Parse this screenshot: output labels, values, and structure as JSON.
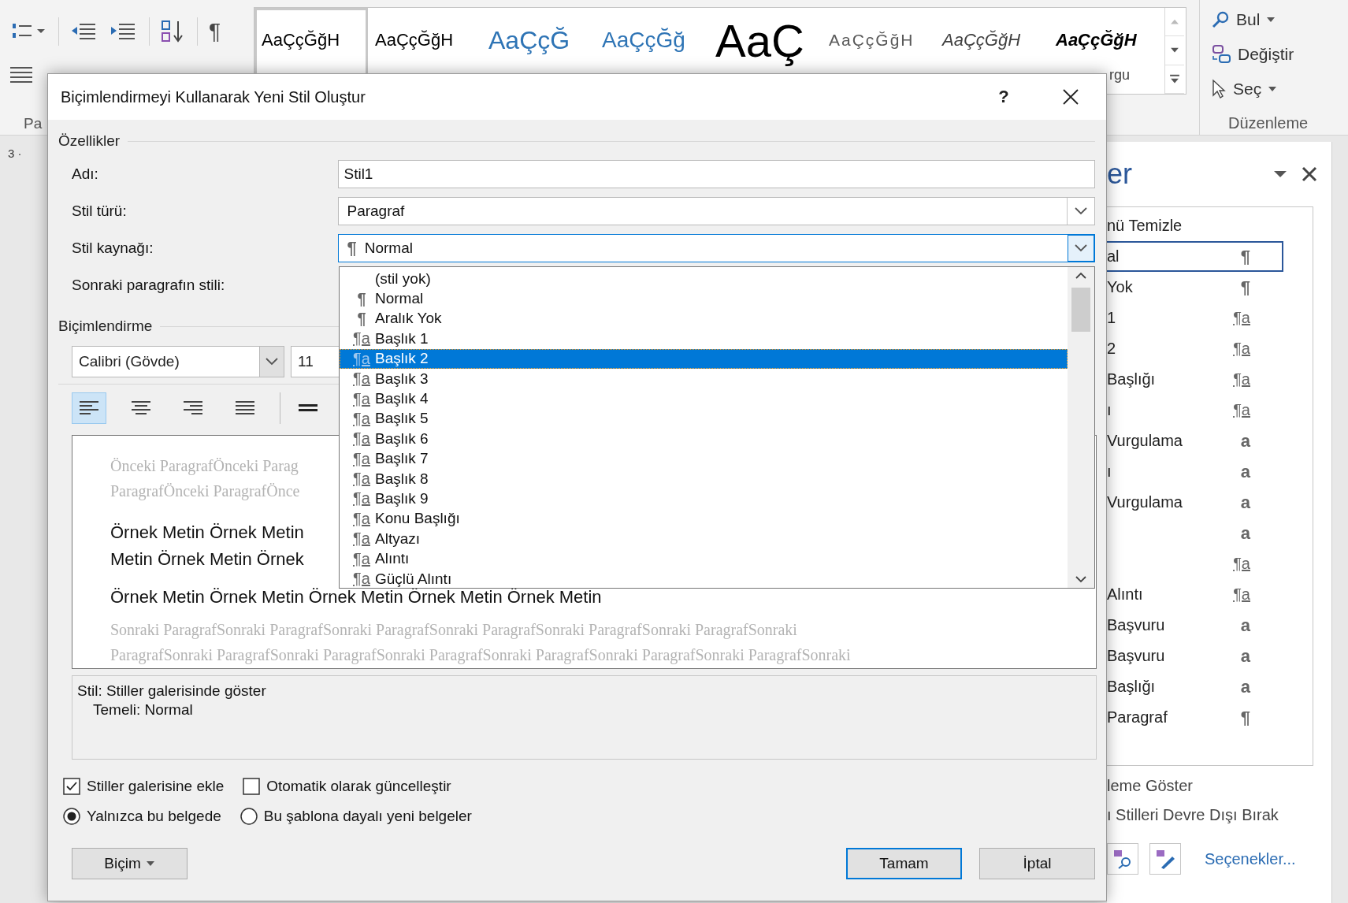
{
  "ribbon": {
    "paragraph_mark": "¶",
    "group_label": "Pa",
    "ruler": "3 ·",
    "gallery": [
      {
        "sample": "AaÇçĞğH",
        "kind": "normal",
        "selected": true
      },
      {
        "sample": "AaÇçĞğH",
        "kind": "no-spacing",
        "selected": false
      },
      {
        "sample": "AaÇçĞ",
        "kind": "heading1",
        "selected": false
      },
      {
        "sample": "AaÇçĞğ",
        "kind": "heading2",
        "selected": false
      },
      {
        "sample": "AaÇ",
        "kind": "title",
        "selected": false
      },
      {
        "sample": "AaÇçĞğH",
        "kind": "subtitle",
        "selected": false
      },
      {
        "sample": "AaÇçĞğH",
        "kind": "subtle-emphasis",
        "selected": false
      },
      {
        "sample": "AaÇçĞğH",
        "kind": "emphasis",
        "selected": false,
        "label": "rgu"
      }
    ],
    "editing": [
      {
        "label": "Bul",
        "kind": "find"
      },
      {
        "label": "Değiştir",
        "kind": "replace"
      },
      {
        "label": "Seç",
        "kind": "select"
      }
    ],
    "editing_group": "Düzenleme"
  },
  "styles_pane": {
    "title": "er",
    "items": [
      {
        "label": "nü Temizle",
        "kind": "clear",
        "selected": false
      },
      {
        "label": "al",
        "mark": "¶",
        "kind": "paragraph",
        "selected": true
      },
      {
        "label": "Yok",
        "mark": "¶",
        "kind": "paragraph",
        "selected": false
      },
      {
        "label": "1",
        "mark": "¶a",
        "kind": "linked",
        "selected": false
      },
      {
        "label": "2",
        "mark": "¶a",
        "kind": "linked",
        "selected": false
      },
      {
        "label": "Başlığı",
        "mark": "¶a",
        "kind": "linked",
        "selected": false
      },
      {
        "label": "ı",
        "mark": "¶a",
        "kind": "linked",
        "selected": false
      },
      {
        "label": "Vurgulama",
        "mark": "a",
        "kind": "character",
        "selected": false
      },
      {
        "label": "ı",
        "mark": "a",
        "kind": "character",
        "selected": false
      },
      {
        "label": "Vurgulama",
        "mark": "a",
        "kind": "character",
        "selected": false
      },
      {
        "mark": "a",
        "kind": "character",
        "selected": false
      },
      {
        "mark": "¶a",
        "kind": "linked",
        "selected": false
      },
      {
        "label": "Alıntı",
        "mark": "¶a",
        "kind": "linked",
        "selected": false
      },
      {
        "label": "Başvuru",
        "mark": "a",
        "kind": "character",
        "selected": false
      },
      {
        "label": "Başvuru",
        "mark": "a",
        "kind": "character",
        "selected": false
      },
      {
        "label": "Başlığı",
        "mark": "a",
        "kind": "character",
        "selected": false
      },
      {
        "label": "Paragraf",
        "mark": "¶",
        "kind": "paragraph",
        "selected": false
      }
    ],
    "links": [
      "leme Göster",
      "ı Stilleri Devre Dışı Bırak"
    ],
    "options_link": "Seçenekler..."
  },
  "dialog": {
    "title": "Biçimlendirmeyi Kullanarak Yeni Stil Oluştur",
    "help": "?",
    "properties": {
      "heading": "Özellikler",
      "fields": [
        {
          "label": "Adı:",
          "kind": "text",
          "value": "Stil1"
        },
        {
          "label": "Stil türü:",
          "kind": "select",
          "value": "Paragraf",
          "open": false
        },
        {
          "label": "Stil kaynağı:",
          "kind": "select",
          "value": "Normal",
          "mark": "¶",
          "open": true
        },
        {
          "label": "Sonraki paragrafın stili:"
        }
      ]
    },
    "dropdown": [
      {
        "label": "(stil yok)",
        "kind": "none",
        "selected": false
      },
      {
        "label": "Normal",
        "mark": "¶",
        "kind": "paragraph",
        "selected": false
      },
      {
        "label": "Aralık Yok",
        "mark": "¶",
        "kind": "paragraph",
        "selected": false
      },
      {
        "label": "Başlık 1",
        "mark": "¶a",
        "kind": "linked",
        "selected": false
      },
      {
        "label": "Başlık 2",
        "mark": "¶a",
        "kind": "linked",
        "selected": true
      },
      {
        "label": "Başlık 3",
        "mark": "¶a",
        "kind": "linked",
        "selected": false
      },
      {
        "label": "Başlık 4",
        "mark": "¶a",
        "kind": "linked",
        "selected": false
      },
      {
        "label": "Başlık 5",
        "mark": "¶a",
        "kind": "linked",
        "selected": false
      },
      {
        "label": "Başlık 6",
        "mark": "¶a",
        "kind": "linked",
        "selected": false
      },
      {
        "label": "Başlık 7",
        "mark": "¶a",
        "kind": "linked",
        "selected": false
      },
      {
        "label": "Başlık 8",
        "mark": "¶a",
        "kind": "linked",
        "selected": false
      },
      {
        "label": "Başlık 9",
        "mark": "¶a",
        "kind": "linked",
        "selected": false
      },
      {
        "label": "Konu Başlığı",
        "mark": "¶a",
        "kind": "linked",
        "selected": false
      },
      {
        "label": "Altyazı",
        "mark": "¶a",
        "kind": "linked",
        "selected": false
      },
      {
        "label": "Alıntı",
        "mark": "¶a",
        "kind": "linked",
        "selected": false
      },
      {
        "label": "Güçlü Alıntı",
        "mark": "¶a",
        "kind": "linked",
        "selected": false
      }
    ],
    "formatting": {
      "heading": "Biçimlendirme",
      "font": "Calibri (Gövde)",
      "size": "11",
      "alignment": [
        {
          "kind": "left",
          "selected": true
        },
        {
          "kind": "center",
          "selected": false
        },
        {
          "kind": "right",
          "selected": false
        },
        {
          "kind": "justify",
          "selected": false
        }
      ]
    },
    "preview": {
      "previous": [
        "Önceki ParagrafÖnceki Parag",
        "ParagrafÖnceki ParagrafÖnce"
      ],
      "sample": [
        "Örnek Metin Örnek Metin",
        "Metin Örnek Metin Örnek",
        "Örnek Metin Örnek Metin Örnek Metin Örnek Metin Örnek Metin"
      ],
      "next": [
        "Sonraki ParagrafSonraki ParagrafSonraki ParagrafSonraki ParagrafSonraki ParagrafSonraki ParagrafSonraki",
        "ParagrafSonraki ParagrafSonraki ParagrafSonraki ParagrafSonraki ParagrafSonraki ParagrafSonraki ParagrafSonraki"
      ]
    },
    "description": [
      "Stil: Stiller galerisinde göster",
      "Temeli: Normal"
    ],
    "checkboxes": [
      {
        "label": "Stiller galerisine ekle",
        "checked": true
      },
      {
        "label": "Otomatik olarak güncelleştir",
        "checked": false
      }
    ],
    "radios": [
      {
        "label": "Yalnızca bu belgede",
        "selected": true
      },
      {
        "label": "Bu şablona dayalı yeni belgeler",
        "selected": false
      }
    ],
    "buttons": [
      {
        "label": "Biçim",
        "kind": "menu"
      },
      {
        "label": "Tamam",
        "kind": "default"
      },
      {
        "label": "İptal",
        "kind": "normal"
      }
    ]
  }
}
